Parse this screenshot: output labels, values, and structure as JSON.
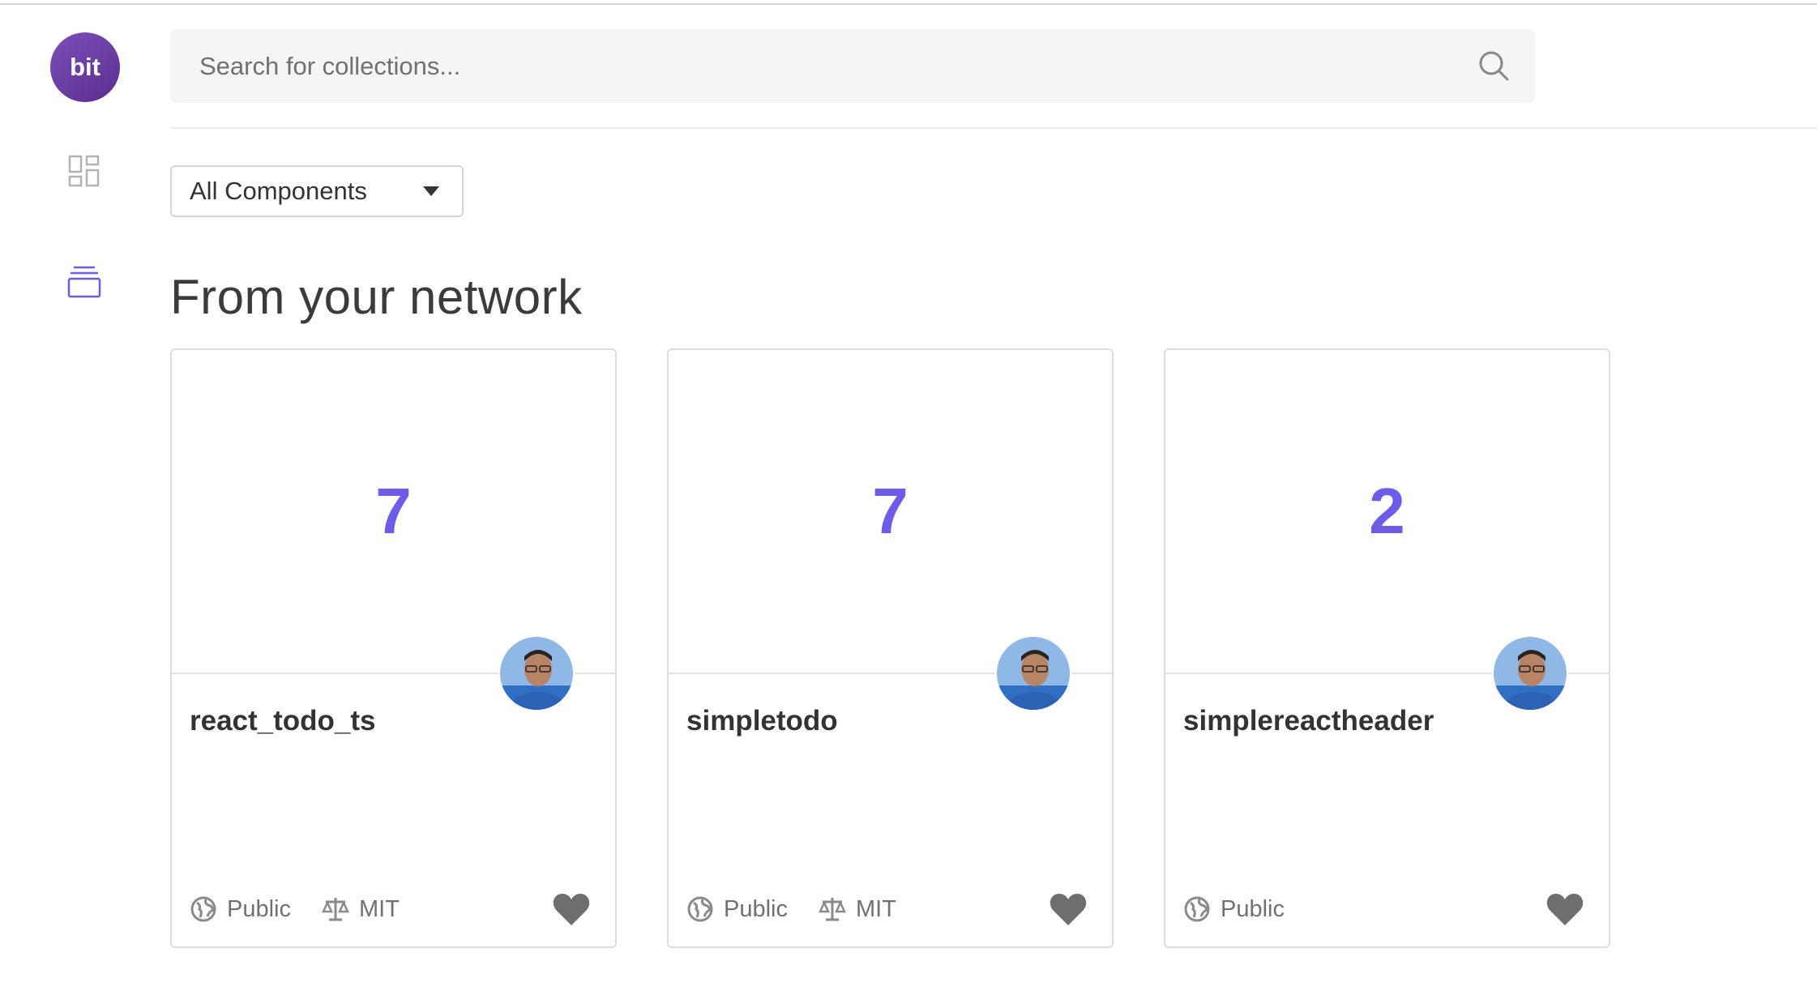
{
  "app": {
    "logo_text": "bit"
  },
  "sidebar": {
    "items": [
      {
        "icon": "grid-icon"
      },
      {
        "icon": "collections-icon"
      }
    ]
  },
  "search": {
    "placeholder": "Search for collections...",
    "value": ""
  },
  "filter": {
    "selected": "All Components"
  },
  "section": {
    "title": "From your network"
  },
  "colors": {
    "accent": "#6c5ce7",
    "logo": "#6a3aa3",
    "heart": "#6e6e6e"
  },
  "cards": [
    {
      "count": "7",
      "name": "react_todo_ts",
      "visibility": "Public",
      "license": "MIT"
    },
    {
      "count": "7",
      "name": "simpletodo",
      "visibility": "Public",
      "license": "MIT"
    },
    {
      "count": "2",
      "name": "simplereactheader",
      "visibility": "Public",
      "license": ""
    }
  ]
}
